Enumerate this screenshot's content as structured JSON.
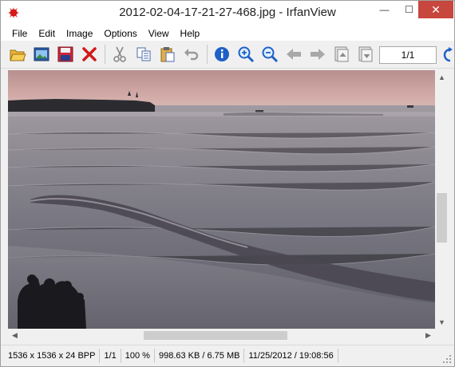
{
  "window": {
    "title": "2012-02-04-17-21-27-468.jpg - IrfanView",
    "min_glyph": "—",
    "max_glyph": "☐",
    "close_glyph": "✕"
  },
  "menu": {
    "items": [
      "File",
      "Edit",
      "Image",
      "Options",
      "View",
      "Help"
    ]
  },
  "toolbar": {
    "buttons": [
      {
        "icon": "open-folder-icon"
      },
      {
        "icon": "slideshow-icon"
      },
      {
        "icon": "save-icon"
      },
      {
        "icon": "delete-icon"
      },
      {
        "icon": "cut-icon"
      },
      {
        "icon": "copy-icon"
      },
      {
        "icon": "paste-icon"
      },
      {
        "icon": "undo-icon"
      },
      {
        "icon": "info-icon"
      },
      {
        "icon": "zoom-in-icon"
      },
      {
        "icon": "zoom-out-icon"
      },
      {
        "icon": "previous-icon"
      },
      {
        "icon": "next-icon"
      },
      {
        "icon": "first-page-icon"
      },
      {
        "icon": "last-page-icon"
      }
    ],
    "page_value": "1/1"
  },
  "statusbar": {
    "dimensions": "1536 x 1536 x 24 BPP",
    "page": "1/1",
    "zoom": "100 %",
    "filesize": "998.63 KB / 6.75 MB",
    "datetime": "11/25/2012 / 19:08:56"
  },
  "colors": {
    "close_button": "#c7463d",
    "sky_top": "#c9a3a0",
    "sea": "#6f6d76"
  }
}
